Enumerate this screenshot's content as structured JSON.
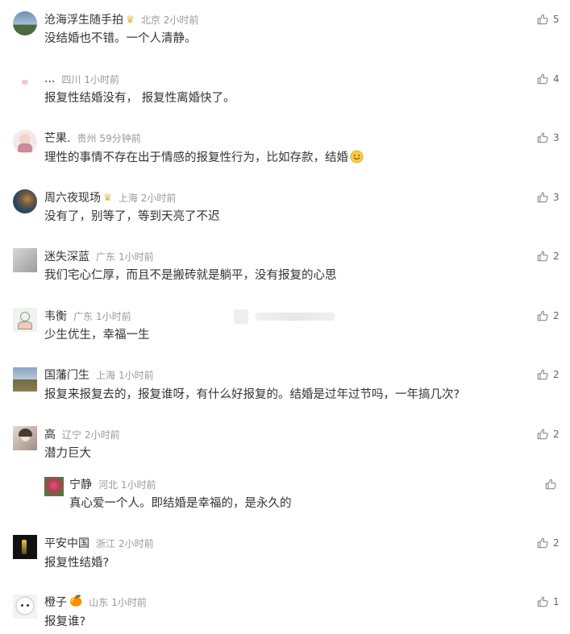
{
  "comments": [
    {
      "name": "沧海浮生随手拍",
      "badge": "Ѡ",
      "location": "北京",
      "time": "2小时前",
      "text": "没结婚也不错。一个人清静。",
      "likes": "5",
      "avatar": "avatar-landscape-icon",
      "avatar_colors": [
        "#6b8fb5",
        "#4a6a3f"
      ]
    },
    {
      "name": "...",
      "badge": "",
      "location": "四川",
      "time": "1小时前",
      "text": "报复性结婚没有， 报复性离婚快了。",
      "likes": "4",
      "avatar": "avatar-small-icon",
      "avatar_colors": [
        "#ffffff",
        "#f4c6cf"
      ]
    },
    {
      "name": "芒果.",
      "badge": "",
      "location": "贵州",
      "time": "59分钟前",
      "text": "理性的事情不存在出于情感的报复性行为，比如存款，结婚",
      "likes": "3",
      "avatar": "avatar-cartoon-icon",
      "avatar_colors": [
        "#f6e8ea",
        "#c98a9a"
      ]
    },
    {
      "name": "周六夜现场",
      "badge": "Ѡ",
      "location": "上海",
      "time": "2小时前",
      "text": "没有了，别等了，等到天亮了不迟",
      "likes": "3",
      "avatar": "avatar-dark-icon",
      "avatar_colors": [
        "#2d4660",
        "#b7884a"
      ]
    },
    {
      "name": "迷失深蓝",
      "badge": "",
      "location": "广东",
      "time": "1小时前",
      "text": "我们宅心仁厚，而且不是搬砖就是躺平，没有报复的心思",
      "likes": "2",
      "avatar": "avatar-gray-icon",
      "avatar_colors": [
        "#c9c9c9",
        "#8f8f8f"
      ]
    },
    {
      "name": "韦衡",
      "badge": "",
      "location": "广东",
      "time": "1小时前",
      "text": "少生优生，幸福一生",
      "likes": "2",
      "avatar": "avatar-cartoon-icon",
      "avatar_colors": [
        "#eef3ee",
        "#a8b9a4"
      ]
    },
    {
      "name": "国藩门生",
      "badge": "",
      "location": "上海",
      "time": "1小时前",
      "text": "报复来报复去的，报复谁呀，有什么好报复的。结婚是过年过节吗，一年搞几次?",
      "likes": "2",
      "avatar": "avatar-landscape-icon",
      "avatar_colors": [
        "#8aa4c2",
        "#6f6a47"
      ]
    },
    {
      "name": "高",
      "badge": "",
      "location": "辽宁",
      "time": "2小时前",
      "text": "潜力巨大",
      "likes": "2",
      "avatar": "avatar-photo-icon",
      "avatar_colors": [
        "#d4c8c1",
        "#7d6b5f"
      ]
    },
    {
      "name": "平安中国",
      "badge": "",
      "location": "浙江",
      "time": "2小时前",
      "text": "报复性结婚?",
      "likes": "2",
      "avatar": "avatar-night-icon",
      "avatar_colors": [
        "#111111",
        "#e6c65a"
      ]
    },
    {
      "name": "橙子",
      "badge": "🍊",
      "location": "山东",
      "time": "1小时前",
      "text": "报复谁?",
      "likes": "1",
      "avatar": "avatar-dog-icon",
      "avatar_colors": [
        "#f3f3f3",
        "#cfcfcf"
      ]
    }
  ],
  "reply": {
    "name": "宁静",
    "location": "河北",
    "time": "1小时前",
    "text": "真心爱一个人。即结婚是幸福的，是永久的",
    "likes": "",
    "avatar": "avatar-flower-icon",
    "avatar_colors": [
      "#b93a57",
      "#4f7a3a"
    ]
  },
  "emoji_name": "smile-emoji-icon",
  "colors": {
    "name": "#333333",
    "meta": "#999999",
    "text": "#333333",
    "like": "#666666"
  }
}
